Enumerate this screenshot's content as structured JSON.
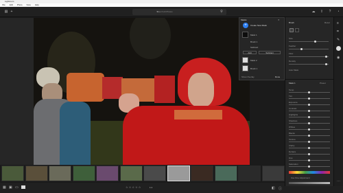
{
  "window": {
    "title": "Lightroom"
  },
  "menu": [
    "File",
    "Edit",
    "Photo",
    "View",
    "Help"
  ],
  "search": {
    "placeholder": "Search All Photos"
  },
  "masks_panel": {
    "title": "Masks",
    "create_label": "Create New Mask",
    "items": [
      {
        "label": "Mask 1"
      },
      {
        "label": "Brush 1"
      },
      {
        "label": "Subtract"
      },
      {
        "label": "Add"
      },
      {
        "label": "Subtract"
      },
      {
        "label": "Mask 2"
      },
      {
        "label": "Brush 1"
      }
    ],
    "footer": {
      "show_overlay": "Show Overlay",
      "done": "Done"
    }
  },
  "right_panel": {
    "section_title": "Brush",
    "reset_label": "Reset",
    "brush_sliders": [
      "Size",
      "Feather",
      "Flow",
      "Density"
    ],
    "autogrow_label": "Auto Mask",
    "mask2_title": "Mask 1",
    "preset_label": "Preset",
    "adjust_sliders": [
      "Temp",
      "Tint",
      "Exposure",
      "Contrast",
      "Highlights",
      "Shadows",
      "Whites",
      "Blacks",
      "Texture",
      "Clarity",
      "Dehaze",
      "Hue",
      "Saturation"
    ],
    "use_fine": "Use Fine Adjustment"
  },
  "filmstrip": {
    "count": 12
  },
  "bottom": {
    "zoom": "1:1"
  }
}
